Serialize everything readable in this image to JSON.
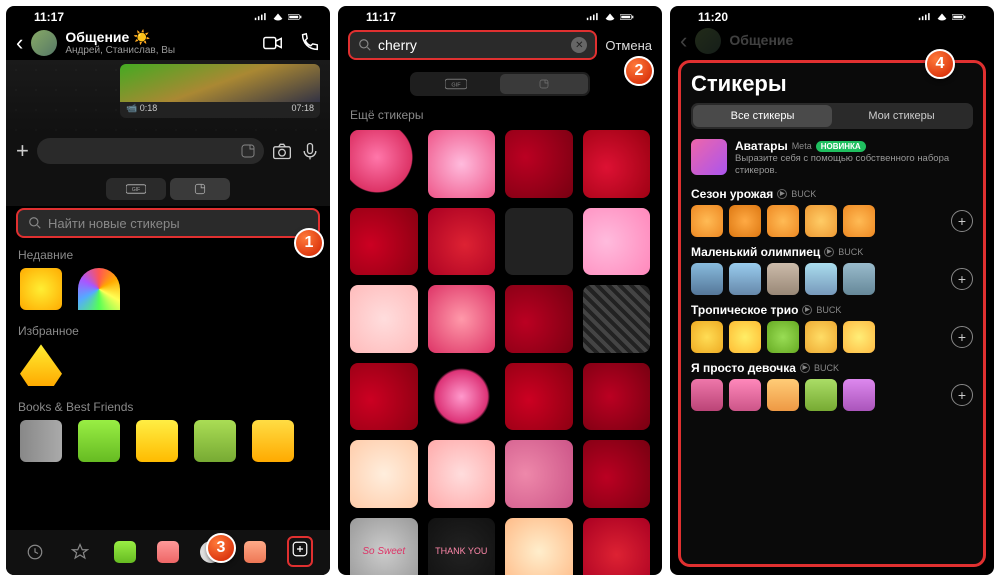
{
  "phone1": {
    "status": {
      "time": "11:17"
    },
    "chat": {
      "title": "Общение",
      "subtitle": "Андрей, Станислав, Вы",
      "videoDuration": "0:18",
      "videoTime": "07:18"
    },
    "segTabs": {
      "gif": "GIF"
    },
    "searchPlaceholder": "Найти новые стикеры",
    "sections": {
      "recent": "Недавние",
      "favorites": "Избранное",
      "books": "Books & Best Friends"
    },
    "callout": "1",
    "callout3": "3"
  },
  "phone2": {
    "status": {
      "time": "11:17"
    },
    "searchValue": "cherry",
    "cancel": "Отмена",
    "segGif": "GIF",
    "sectionLabel": "Ещё стикеры",
    "callout": "2"
  },
  "phone3": {
    "status": {
      "time": "11:20"
    },
    "dimTitle": "Общение",
    "title": "Стикеры",
    "segTabs": {
      "all": "Все стикеры",
      "mine": "Мои стикеры"
    },
    "avatars": {
      "title": "Аватары",
      "meta": "Meta",
      "badge": "НОВИНКА",
      "desc": "Выразите себя с помощью собственного набора стикеров."
    },
    "packs": [
      {
        "name": "Сезон урожая",
        "author": "BUCK"
      },
      {
        "name": "Маленький олимпиец",
        "author": "BUCK"
      },
      {
        "name": "Тропическое трио",
        "author": "BUCK"
      },
      {
        "name": "Я просто девочка",
        "author": "BUCK"
      }
    ],
    "callout": "4"
  }
}
